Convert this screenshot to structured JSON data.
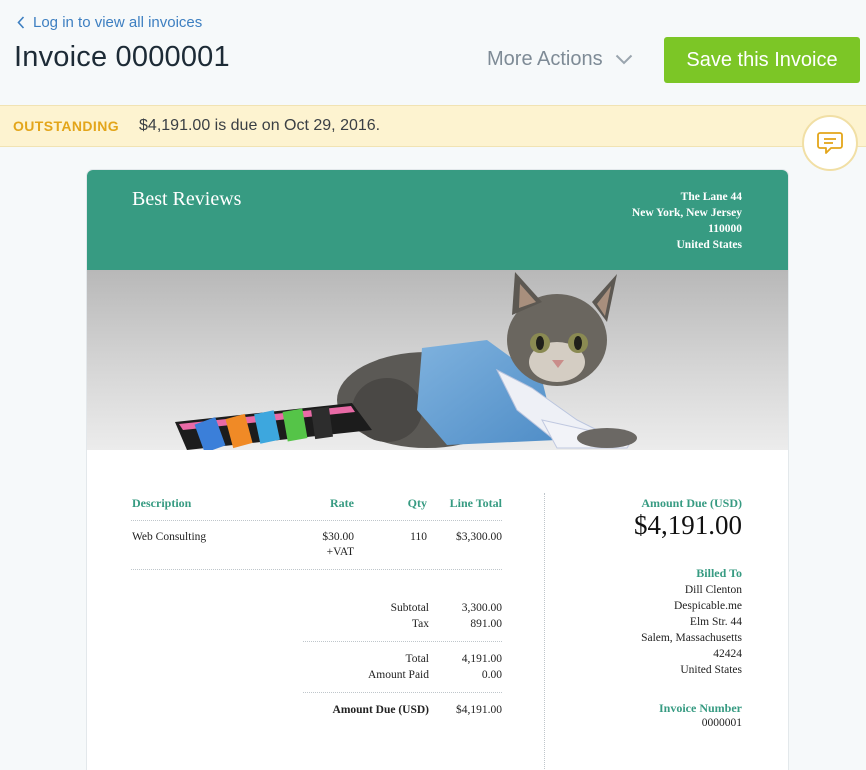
{
  "nav": {
    "back_label": "Log in to view all invoices"
  },
  "page": {
    "title": "Invoice 0000001"
  },
  "actions": {
    "more_actions": "More Actions",
    "save": "Save this Invoice"
  },
  "status": {
    "badge": "OUTSTANDING",
    "message": "$4,191.00 is due on Oct 29, 2016."
  },
  "colors": {
    "accent": "#379b82",
    "save_button": "#7cc626",
    "status_bg": "#fdf3d0",
    "status_badge": "#e3a51a",
    "link": "#3d7fc1"
  },
  "icons": {
    "back": "chevron-left-icon",
    "more": "chevron-down-icon",
    "chat": "chat-bubble-icon"
  },
  "invoice": {
    "company": "Best Reviews",
    "address": [
      "The Lane 44",
      "New York, New Jersey",
      "110000",
      "United States"
    ],
    "columns": {
      "description": "Description",
      "rate": "Rate",
      "qty": "Qty",
      "line_total": "Line Total"
    },
    "items": [
      {
        "description": "Web Consulting",
        "rate": "$30.00",
        "rate_note": "+VAT",
        "qty": "110",
        "line_total": "$3,300.00"
      }
    ],
    "totals": {
      "subtotal_label": "Subtotal",
      "subtotal": "3,300.00",
      "tax_label": "Tax",
      "tax": "891.00",
      "total_label": "Total",
      "total": "4,191.00",
      "paid_label": "Amount Paid",
      "paid": "0.00",
      "due_label": "Amount Due (USD)",
      "due": "$4,191.00"
    },
    "summary": {
      "amount_due_label": "Amount Due (USD)",
      "amount_due": "$4,191.00",
      "billed_to_label": "Billed To",
      "billed_to": [
        "Dill Clenton",
        "Despicable.me",
        "Elm Str. 44",
        "Salem, Massachusetts",
        "42424",
        "United States"
      ],
      "invoice_number_label": "Invoice Number",
      "invoice_number": "0000001"
    }
  }
}
